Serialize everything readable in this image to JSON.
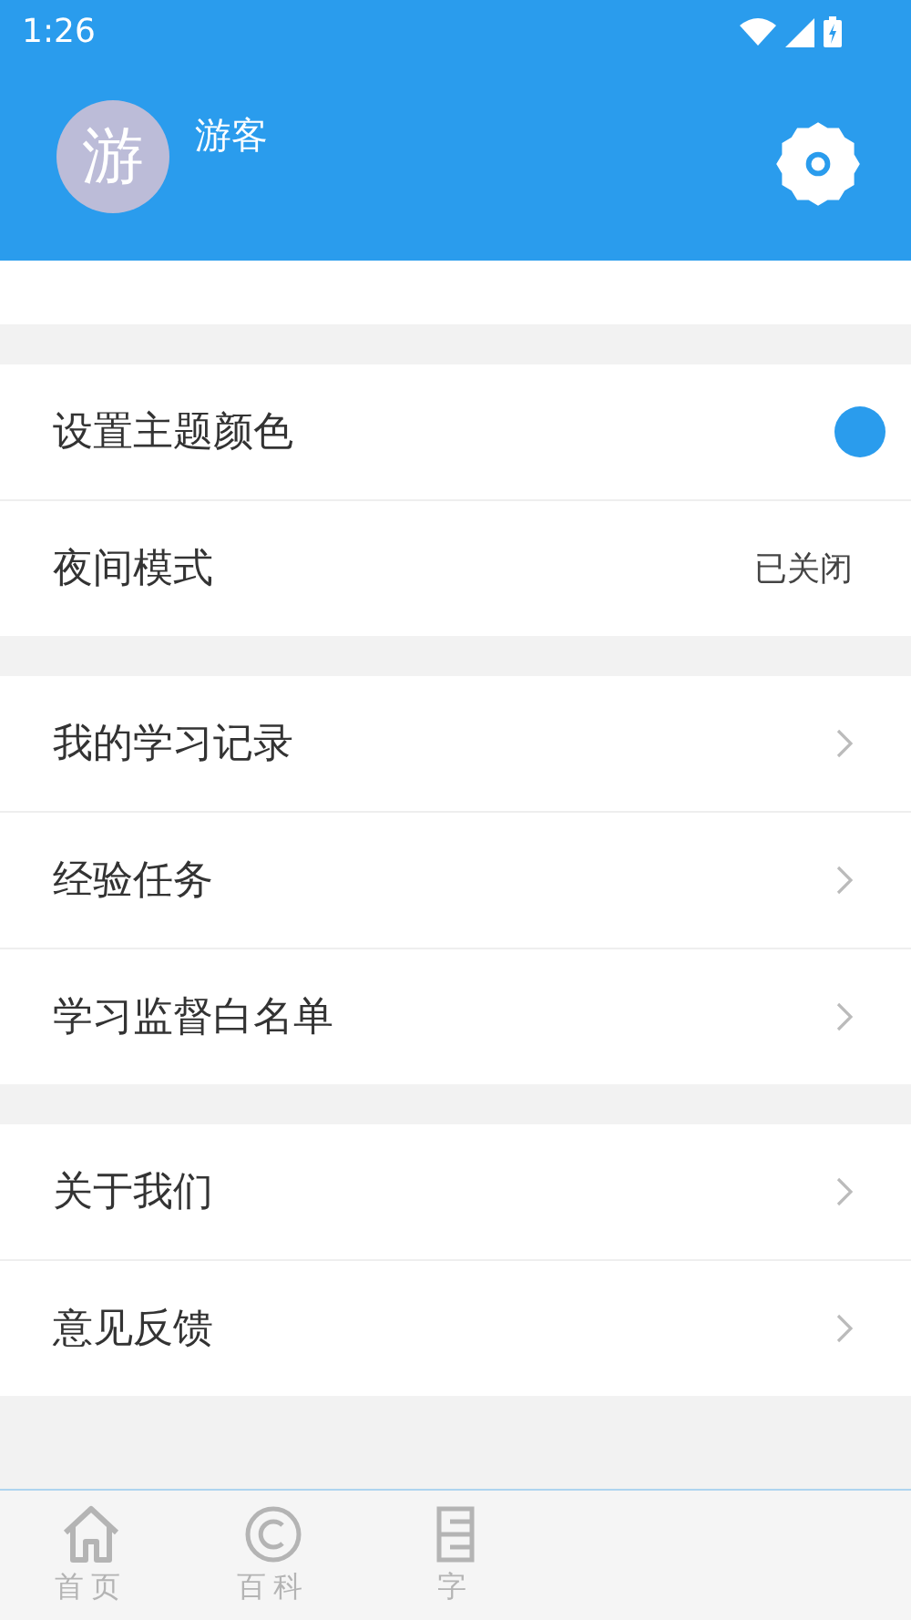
{
  "status_bar": {
    "time": "1:26"
  },
  "profile": {
    "avatar_text": "游",
    "name": "游客"
  },
  "sections": [
    {
      "rows": [
        {
          "kind": "color",
          "label": "设置主题颜色",
          "color": "#2a9ced"
        },
        {
          "kind": "value",
          "label": "夜间模式",
          "value": "已关闭"
        }
      ]
    },
    {
      "rows": [
        {
          "kind": "link",
          "label": "我的学习记录"
        },
        {
          "kind": "link",
          "label": "经验任务"
        },
        {
          "kind": "link",
          "label": "学习监督白名单"
        }
      ]
    },
    {
      "rows": [
        {
          "kind": "link",
          "label": "关于我们"
        },
        {
          "kind": "link",
          "label": "意见反馈"
        }
      ]
    }
  ],
  "tab_bar": [
    {
      "kind": "home",
      "label": "首页",
      "selected": false
    },
    {
      "kind": "copyright",
      "label": "百科",
      "selected": false
    },
    {
      "kind": "list",
      "label": "字",
      "selected": false
    }
  ]
}
